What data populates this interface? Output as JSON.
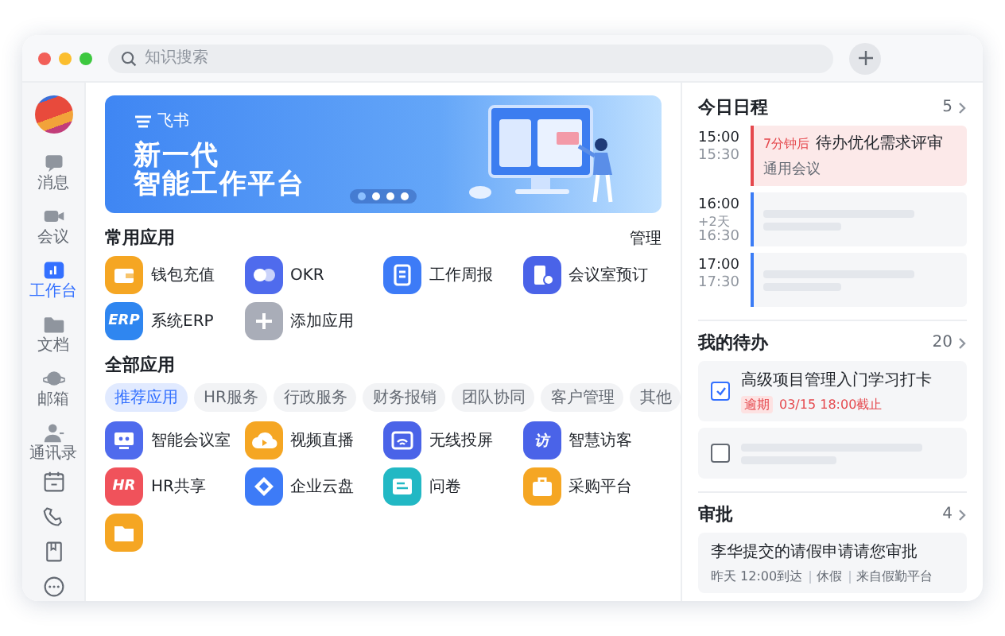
{
  "search": {
    "placeholder": "知识搜索"
  },
  "sidebar": {
    "items": [
      {
        "label": "消息",
        "kind": "chat",
        "selected": false
      },
      {
        "label": "会议",
        "kind": "video",
        "selected": false
      },
      {
        "label": "工作台",
        "kind": "chart",
        "selected": true
      },
      {
        "label": "文档",
        "kind": "folder",
        "selected": false
      },
      {
        "label": "邮箱",
        "kind": "planet",
        "selected": false
      },
      {
        "label": "通讯录",
        "kind": "person",
        "selected": false
      }
    ]
  },
  "banner": {
    "brand": "飞书",
    "title_lines": [
      "新一代",
      "智能工作平台"
    ],
    "slides": [
      {
        "selected": true
      },
      {
        "selected": false
      },
      {
        "selected": false
      },
      {
        "selected": false
      }
    ]
  },
  "common_apps": {
    "title": "常用应用",
    "action": "管理",
    "apps": [
      {
        "label": "钱包充值",
        "kind": "wallet",
        "color": "#f5a623"
      },
      {
        "label": "OKR",
        "kind": "circles",
        "color": "#4f6bed"
      },
      {
        "label": "工作周报",
        "kind": "document",
        "color": "#3d7bf7"
      },
      {
        "label": "会议室预订",
        "kind": "door",
        "color": "#4a63e8"
      },
      {
        "label": "系统ERP",
        "logo": "ERP",
        "color": "#2f86f0"
      },
      {
        "label": "添加应用",
        "kind": "plus",
        "color": "#a9adb8"
      }
    ]
  },
  "all_apps": {
    "title": "全部应用",
    "tabs": [
      {
        "label": "推荐应用",
        "selected": true
      },
      {
        "label": "HR服务",
        "selected": false
      },
      {
        "label": "行政服务",
        "selected": false
      },
      {
        "label": "财务报销",
        "selected": false
      },
      {
        "label": "团队协同",
        "selected": false
      },
      {
        "label": "客户管理",
        "selected": false
      },
      {
        "label": "其他",
        "selected": false
      }
    ],
    "apps": [
      {
        "label": "智能会议室",
        "kind": "monitor",
        "color": "#4f6bed"
      },
      {
        "label": "视频直播",
        "kind": "cloud",
        "color": "#f5a623"
      },
      {
        "label": "无线投屏",
        "kind": "screen",
        "color": "#4a63e8"
      },
      {
        "label": "智慧访客",
        "logo": "访",
        "color": "#4a63e8"
      },
      {
        "label": "HR共享",
        "logo": "HR",
        "color": "#f0525b"
      },
      {
        "label": "企业云盘",
        "kind": "diamond",
        "color": "#3d7bf7"
      },
      {
        "label": "问卷",
        "kind": "card",
        "color": "#22b8c4"
      },
      {
        "label": "采购平台",
        "kind": "briefcase",
        "color": "#f5a623"
      },
      {
        "kind": "folder",
        "color": "#f5a623"
      }
    ]
  },
  "schedule": {
    "title": "今日日程",
    "count": "5",
    "events": [
      {
        "start": "15:00",
        "end": "15:30",
        "color": "#e5484d",
        "tag": "7分钟后",
        "title": "待办优化需求评审",
        "subtitle": "通用会议"
      },
      {
        "start": "16:00",
        "note": "+2天",
        "end": "16:30",
        "color": "#3b7cf6"
      },
      {
        "start": "17:00",
        "end": "17:30",
        "color": "#3b7cf6"
      }
    ]
  },
  "todos": {
    "title": "我的待办",
    "count": "20",
    "items": [
      {
        "checked": true,
        "title": "高级项目管理入门学习打卡",
        "tag": "逾期",
        "due": "03/15 18:00截止"
      },
      {
        "checked": false
      }
    ]
  },
  "approvals": {
    "title": "审批",
    "count": "4",
    "items": [
      {
        "title": "李华提交的请假申请请您审批",
        "meta": [
          "昨天 12:00到达",
          "休假",
          "来自假勤平台"
        ]
      }
    ]
  }
}
